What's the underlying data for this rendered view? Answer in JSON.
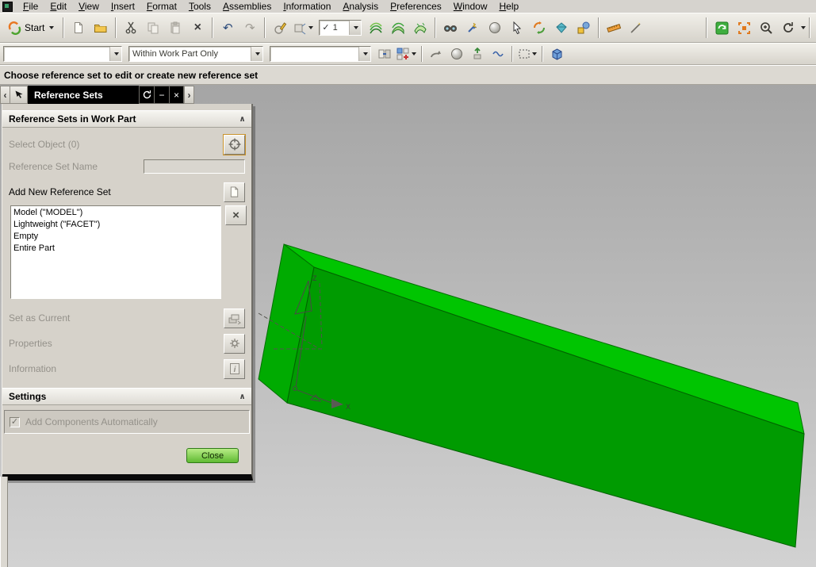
{
  "menu": {
    "items": [
      "File",
      "Edit",
      "View",
      "Insert",
      "Format",
      "Tools",
      "Assemblies",
      "Information",
      "Analysis",
      "Preferences",
      "Window",
      "Help"
    ]
  },
  "toolbar_main": {
    "start_label": "Start",
    "layer_value": "1"
  },
  "toolbar_assembly": {
    "component_value": "",
    "scope_value": "Within Work Part Only",
    "search_value": ""
  },
  "prompt": {
    "text": "Choose reference set to edit or create new reference set"
  },
  "dialog": {
    "title": "Reference Sets",
    "header": "Reference Sets in Work Part",
    "select_object_label": "Select Object (0)",
    "reference_set_name_label": "Reference Set Name",
    "reference_set_name_value": "",
    "add_new_label": "Add New Reference Set",
    "reference_sets": [
      "Model (\"MODEL\")",
      "Lightweight (\"FACET\")",
      "Empty",
      "Entire Part"
    ],
    "set_as_current_label": "Set as Current",
    "properties_label": "Properties",
    "information_label": "Information",
    "settings_label": "Settings",
    "add_components_label": "Add Components Automatically",
    "close_label": "Close"
  },
  "viewport": {
    "triad": {
      "z": "Z",
      "x": "X"
    }
  },
  "glyphs": {
    "undo": "↶",
    "redo": "↷",
    "check": "✓",
    "collapse": "∧",
    "back": "‹",
    "forward": "›",
    "minimize": "−",
    "close": "×",
    "remove": "×",
    "delete": "×"
  },
  "colors": {
    "beam_top": "#00c501",
    "beam_front": "#009b01",
    "beam_end": "#00ab01",
    "beam_edge": "#007101",
    "viewport_top": "#a5a5a5",
    "viewport_bottom": "#d2d2d2",
    "close_button": "#5fba32",
    "dialog_title_bg": "#000000"
  }
}
